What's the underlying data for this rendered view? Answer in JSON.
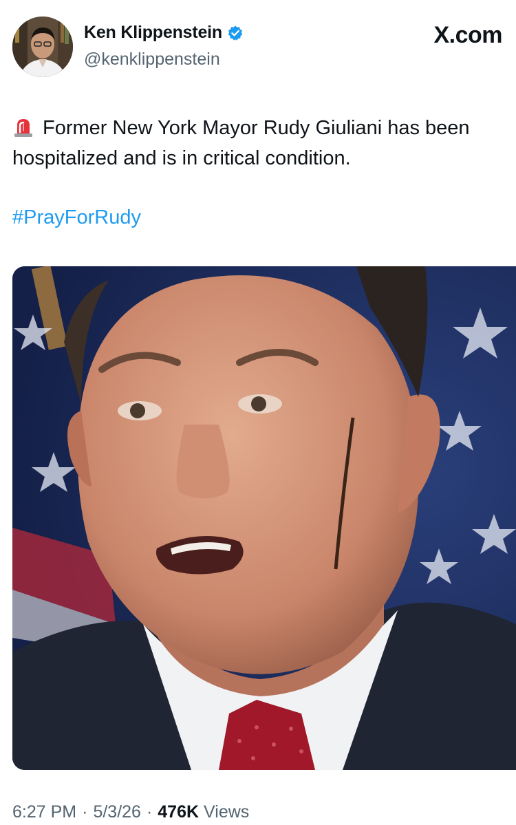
{
  "author": {
    "display_name": "Ken Klippenstein",
    "handle": "@kenklippenstein",
    "verified": true,
    "avatar_icon": "profile-photo"
  },
  "brand": "X.com",
  "tweet": {
    "emoji_icon": "police-siren-icon",
    "text": "Former New York Mayor Rudy Giuliani has been hospitalized and is in critical condition.",
    "hashtag": "#PrayForRudy"
  },
  "meta": {
    "time": "6:27 PM",
    "date": "5/3/26",
    "separator": "·",
    "views_count": "476K",
    "views_label": "Views"
  },
  "colors": {
    "link": "#1d9bf0",
    "verified_badge": "#1d9bf0",
    "secondary_text": "#536471",
    "primary_text": "#0f1419"
  }
}
